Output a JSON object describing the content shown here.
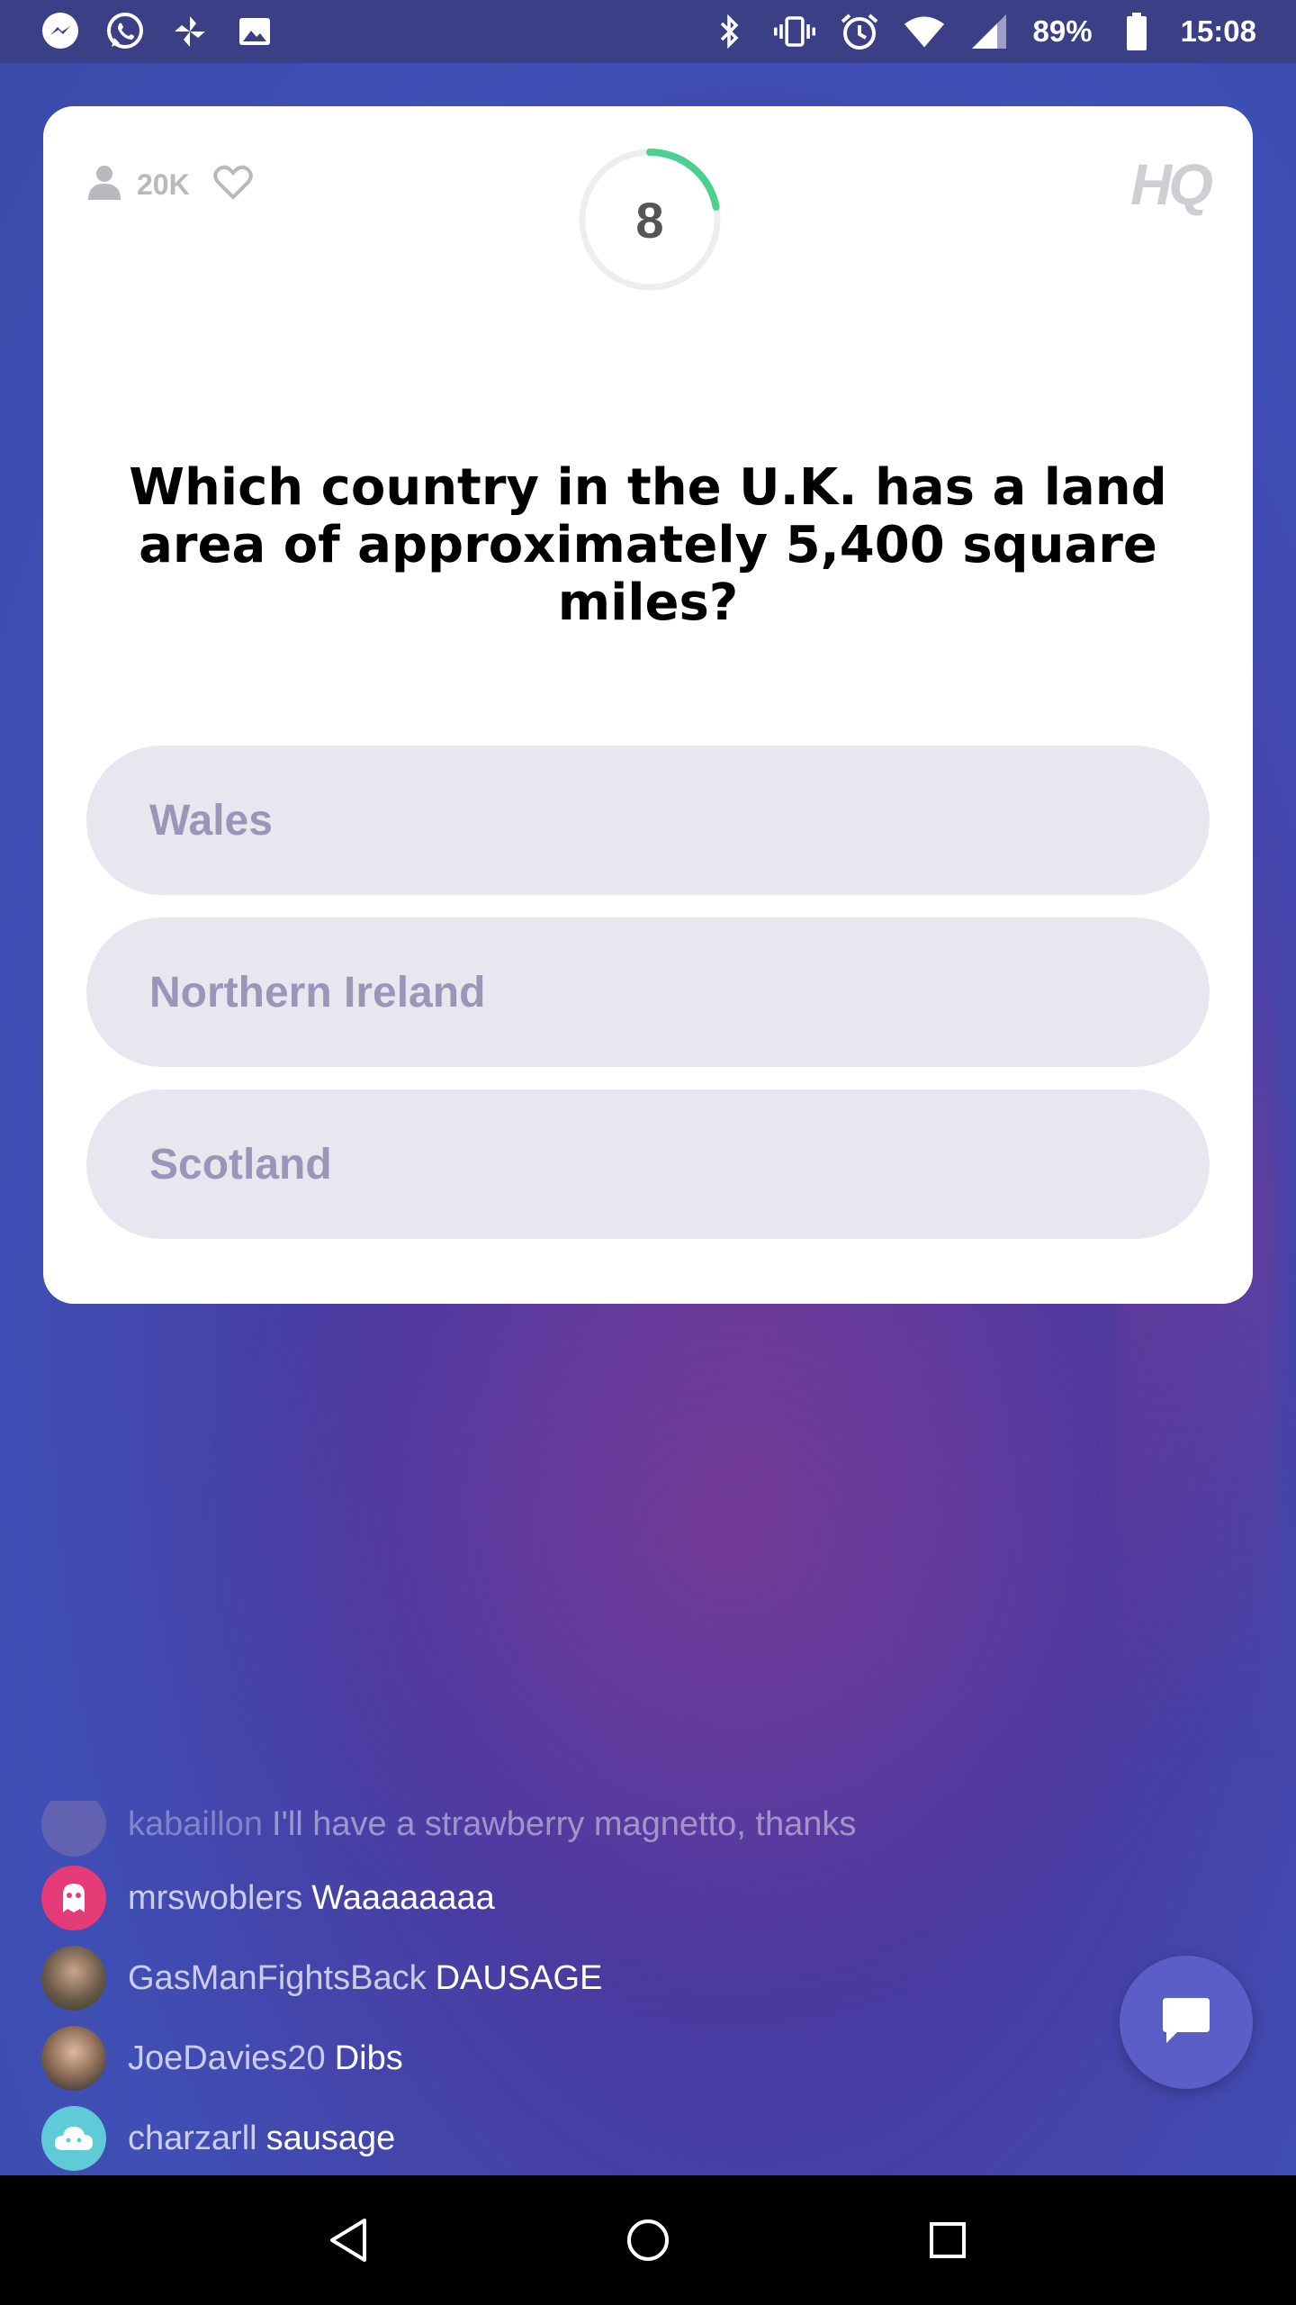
{
  "status_bar": {
    "battery": "89%",
    "time": "15:08",
    "left_icons": [
      "messenger-icon",
      "whatsapp-icon",
      "pinwheel-icon",
      "gallery-icon"
    ],
    "right_icons": [
      "bluetooth-icon",
      "vibrate-icon",
      "alarm-icon",
      "wifi-icon",
      "signal-icon",
      "battery-icon"
    ]
  },
  "card": {
    "viewer_count": "20K",
    "timer": "8",
    "timer_progress": 0.22,
    "logo": "HQ",
    "question": "Which country in the U.K. has a land area of approximately 5,400 square miles?",
    "answers": [
      "Wales",
      "Northern Ireland",
      "Scotland"
    ]
  },
  "chat": {
    "messages": [
      {
        "user": "kabaillon",
        "text": "I'll have a strawberry magnetto, thanks"
      },
      {
        "user": "mrswoblers",
        "text": "Waaaaaaaa"
      },
      {
        "user": "GasManFightsBack",
        "text": "DAUSAGE"
      },
      {
        "user": "JoeDavies20",
        "text": "Dibs"
      },
      {
        "user": "charzarll",
        "text": "sausage"
      }
    ]
  },
  "colors": {
    "accent_green": "#4cd08f",
    "answer_bg": "#e8e7ef",
    "answer_text": "#9a96b8",
    "chat_button": "#5b5ec6"
  }
}
